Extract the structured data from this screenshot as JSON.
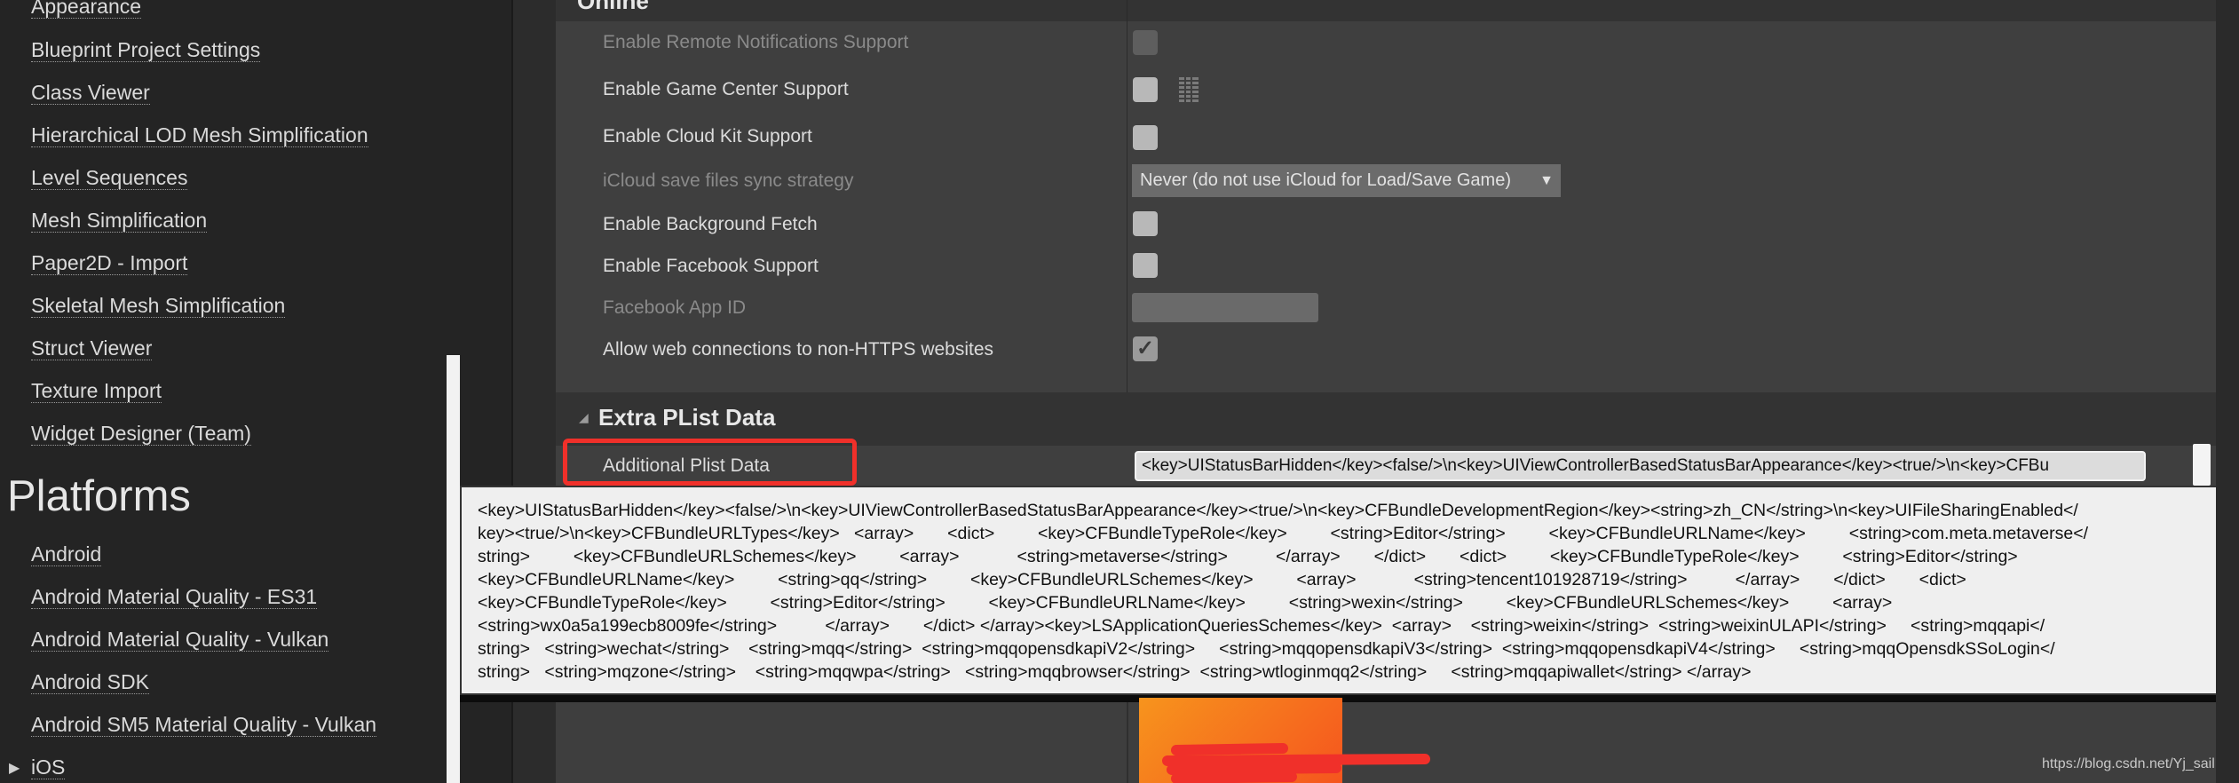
{
  "sidebar": {
    "items": [
      {
        "label": "Appearance"
      },
      {
        "label": "Blueprint Project Settings"
      },
      {
        "label": "Class Viewer"
      },
      {
        "label": "Hierarchical LOD Mesh Simplification"
      },
      {
        "label": "Level Sequences"
      },
      {
        "label": "Mesh Simplification"
      },
      {
        "label": "Paper2D - Import"
      },
      {
        "label": "Skeletal Mesh Simplification"
      },
      {
        "label": "Struct Viewer"
      },
      {
        "label": "Texture Import"
      },
      {
        "label": "Widget Designer (Team)"
      }
    ],
    "platforms_heading": "Platforms",
    "platform_items": [
      {
        "label": "Android"
      },
      {
        "label": "Android Material Quality - ES31"
      },
      {
        "label": "Android Material Quality - Vulkan"
      },
      {
        "label": "Android SDK"
      },
      {
        "label": "Android SM5 Material Quality - Vulkan"
      },
      {
        "label": "iOS"
      }
    ]
  },
  "online": {
    "title": "Online",
    "rows": [
      {
        "label": "Enable Remote Notifications Support",
        "enabled": false,
        "checked": false
      },
      {
        "label": "Enable Game Center Support",
        "enabled": true,
        "checked": false
      },
      {
        "label": "Enable Cloud Kit Support",
        "enabled": true,
        "checked": false
      },
      {
        "label": "iCloud save files sync strategy",
        "enabled": false,
        "value": "Never (do not use iCloud for Load/Save Game)"
      },
      {
        "label": "Enable Background Fetch",
        "enabled": true,
        "checked": false
      },
      {
        "label": "Enable Facebook Support",
        "enabled": true,
        "checked": false
      },
      {
        "label": "Facebook App ID",
        "enabled": false,
        "value": ""
      },
      {
        "label": "Allow web connections to non-HTTPS websites",
        "enabled": true,
        "checked": true
      }
    ]
  },
  "extra_plist": {
    "title": "Extra PList Data",
    "label": "Additional Plist Data",
    "value": "<key>UIStatusBarHidden</key><false/>\\n<key>UIViewControllerBasedStatusBarAppearance</key><true/>\\n<key>CFBu"
  },
  "tooltip": {
    "lines": [
      "<key>UIStatusBarHidden</key><false/>\\n<key>UIViewControllerBasedStatusBarAppearance</key><true/>\\n<key>CFBundleDevelopmentRegion</key><string>zh_CN</string>\\n<key>UIFileSharingEnabled</",
      "key><true/>\\n<key>CFBundleURLTypes</key>   <array>       <dict>         <key>CFBundleTypeRole</key>         <string>Editor</string>         <key>CFBundleURLName</key>         <string>com.meta.metaverse</",
      "string>         <key>CFBundleURLSchemes</key>         <array>            <string>metaverse</string>          </array>       </dict>       <dict>         <key>CFBundleTypeRole</key>         <string>Editor</string>",
      "<key>CFBundleURLName</key>         <string>qq</string>         <key>CFBundleURLSchemes</key>         <array>            <string>tencent101928719</string>          </array>       </dict>       <dict>",
      "<key>CFBundleTypeRole</key>         <string>Editor</string>         <key>CFBundleURLName</key>         <string>wexin</string>         <key>CFBundleURLSchemes</key>         <array>",
      "<string>wx0a5a199ecb8009fe</string>          </array>       </dict> </array><key>LSApplicationQueriesSchemes</key>  <array>    <string>weixin</string>  <string>weixinULAPI</string>     <string>mqqapi</",
      "string>   <string>wechat</string>    <string>mqq</string>  <string>mqqopensdkapiV2</string>     <string>mqqopensdkapiV3</string>  <string>mqqopensdkapiV4</string>     <string>mqqOpensdkSSoLogin</",
      "string>   <string>mqzone</string>    <string>mqqwpa</string>   <string>mqqbrowser</string>  <string>wtloginmqq2</string>     <string>mqqapiwallet</string> </array>"
    ]
  },
  "watermark": "https://blog.csdn.net/Yj_sail",
  "colors": {
    "highlight": "#f0302a",
    "app_icon": "#f7941d"
  }
}
